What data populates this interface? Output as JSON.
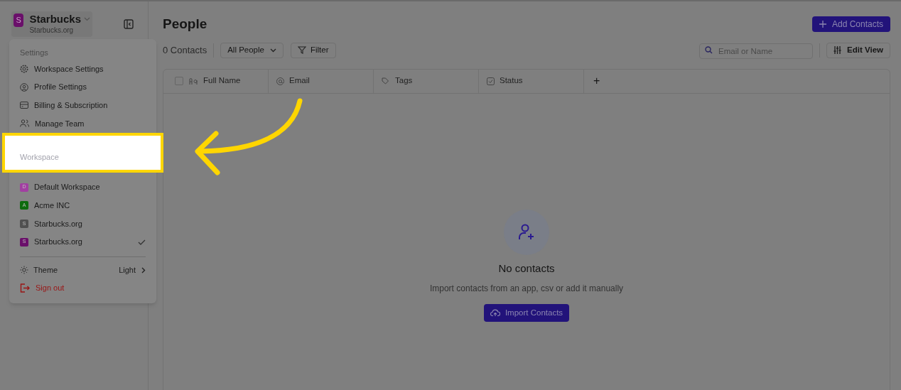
{
  "sidebar": {
    "workspace": {
      "avatar": "S",
      "name": "Starbucks",
      "subtitle": "Starbucks.org"
    }
  },
  "menu": {
    "settings_heading": "Settings",
    "settings_items": [
      {
        "kind": "gear",
        "label": "Workspace Settings"
      },
      {
        "kind": "profile",
        "label": "Profile Settings"
      },
      {
        "kind": "card",
        "label": "Billing & Subscription"
      },
      {
        "kind": "team",
        "label": "Manage Team"
      }
    ],
    "workspace_heading": "Workspace",
    "workspaces": [
      {
        "avatar": "D",
        "name": "Default Workspace",
        "color": "#a23fa2",
        "selected": false
      },
      {
        "avatar": "A",
        "name": "Acme INC",
        "color": "#0f6b0f",
        "selected": false
      },
      {
        "avatar": "S",
        "name": "Starbucks.org",
        "color": "#505050",
        "selected": false
      },
      {
        "avatar": "S",
        "name": "Starbucks.org",
        "color": "#6a0f6a",
        "selected": true
      }
    ],
    "theme": {
      "label": "Theme",
      "value": "Light"
    },
    "sign_out": "Sign out"
  },
  "main": {
    "title": "People",
    "add_button": "Add Contacts",
    "count": "0 Contacts",
    "view_select": "All People",
    "filter_button": "Filter",
    "search": {
      "placeholder": "Email or Name"
    },
    "edit_view": "Edit View",
    "select_all": {
      "checked": false
    },
    "columns": [
      {
        "kind": "name",
        "label": "Full Name"
      },
      {
        "kind": "email",
        "label": "Email"
      },
      {
        "kind": "tags",
        "label": "Tags"
      },
      {
        "kind": "status",
        "label": "Status"
      }
    ],
    "add_column": "+",
    "empty": {
      "title": "No contacts",
      "message": "Import contacts from an app, csv or add it manually",
      "button": "Import Contacts"
    }
  }
}
